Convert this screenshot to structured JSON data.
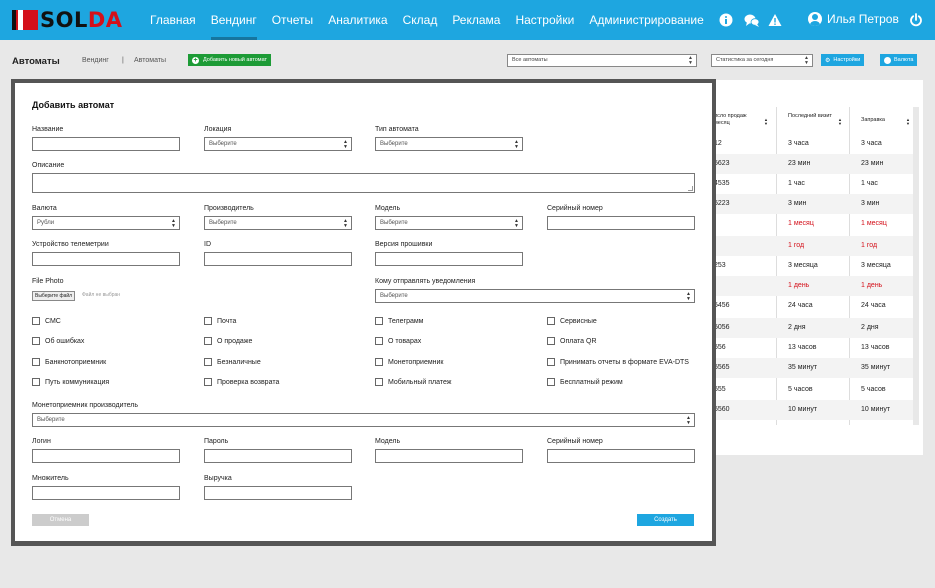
{
  "header": {
    "logo_sol": "SOL",
    "logo_da": "DA",
    "nav": [
      "Главная",
      "Вендинг",
      "Отчеты",
      "Аналитика",
      "Склад",
      "Реклама",
      "Настройки",
      "Администрирование"
    ],
    "active_nav": "Вендинг",
    "user_name": "Илья Петров",
    "brand_color": "#1ea6e0"
  },
  "toolbar": {
    "title": "Автоматы",
    "crumb_1": "Вендинг",
    "crumb_sep": "|",
    "crumb_2": "Автоматы",
    "add_button": "Добавить новый автомат",
    "select_machines": "Все автоматы",
    "select_stats": "Статистика за сегодня",
    "settings_button": "Настройки",
    "currency_button": "Валюта"
  },
  "table": {
    "headers": [
      "исло продаж\nмесяц",
      "Последний визит",
      "Заправка"
    ],
    "rows": [
      {
        "sales": "12",
        "visit": "3 часа",
        "refill": "3 часа",
        "red": false
      },
      {
        "sales": "5623",
        "visit": "23 мин",
        "refill": "23 мин",
        "red": false
      },
      {
        "sales": "4535",
        "visit": "1 час",
        "refill": "1 час",
        "red": false
      },
      {
        "sales": "5223",
        "visit": "3 мин",
        "refill": "3 мин",
        "red": false
      },
      {
        "sales": "",
        "visit": "1 месяц",
        "refill": "1 месяц",
        "red": true
      },
      {
        "sales": "",
        "visit": "1 год",
        "refill": "1 год",
        "red": true
      },
      {
        "sales": "253",
        "visit": "3 месяца",
        "refill": "3 месяца",
        "red": false
      },
      {
        "sales": "",
        "visit": "1 день",
        "refill": "1 день",
        "red": true
      },
      {
        "sales": "5456",
        "visit": "24 часа",
        "refill": "24 часа",
        "red": false
      },
      {
        "sales": "5056",
        "visit": "2 дня",
        "refill": "2 дня",
        "red": false
      },
      {
        "sales": "556",
        "visit": "13 часов",
        "refill": "13 часов",
        "red": false
      },
      {
        "sales": "5565",
        "visit": "35 минут",
        "refill": "35 минут",
        "red": false
      },
      {
        "sales": "555",
        "visit": "5 часов",
        "refill": "5 часов",
        "red": false
      },
      {
        "sales": "5560",
        "visit": "10 минут",
        "refill": "10 минут",
        "red": false
      }
    ]
  },
  "modal": {
    "title": "Добавить автомат",
    "name_label": "Название",
    "location_label": "Локация",
    "location_value": "Выберите",
    "type_label": "Тип автомата",
    "type_value": "Выберите",
    "description_label": "Описание",
    "currency_label": "Валюта",
    "currency_value": "Рубли",
    "manufacturer_label": "Производитель",
    "manufacturer_value": "Выберите",
    "model_label": "Модель",
    "model_value": "Выберите",
    "serial_label": "Серийный номер",
    "telemetry_label": "Устройство телеметрии",
    "id_label": "ID",
    "firmware_label": "Версия прошивки",
    "photo_label": "File Photo",
    "file_button": "Выберите файл",
    "file_status": "Файл не выбран",
    "notify_label": "Кому отправлять уведомления",
    "notify_value": "Выберите",
    "checkboxes": [
      "СМС",
      "Почта",
      "Телеграмм",
      "Сервисные",
      "Об ошибках",
      "О продаже",
      "О товарах",
      "Оплата QR",
      "Банкнотоприемник",
      "Безналичные",
      "Монетоприемник",
      "Принимать отчеты в формате EVA-DTS",
      "Путь коммуникация",
      "Проверка возврата",
      "Мобильный платеж",
      "Бесплатный режим"
    ],
    "coin_maker_label": "Монетоприемник производитель",
    "coin_maker_value": "Выберите",
    "login_label": "Логин",
    "password_label": "Пароль",
    "model2_label": "Модель",
    "serial2_label": "Серийный номер",
    "multiplier_label": "Множитель",
    "revenue_label": "Выручка",
    "cancel_button": "Отмена",
    "create_button": "Создать"
  }
}
